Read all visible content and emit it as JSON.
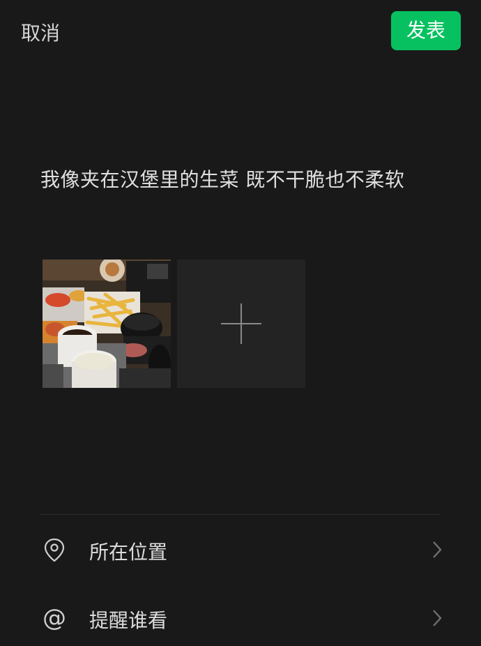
{
  "header": {
    "cancel_label": "取消",
    "publish_label": "发表"
  },
  "post": {
    "text": "我像夹在汉堡里的生菜 既不干脆也不柔软"
  },
  "media": {
    "photos": [
      {
        "description_icon": "photo-thumbnail"
      }
    ],
    "add_icon": "plus-icon"
  },
  "options": {
    "location": {
      "label": "所在位置",
      "icon": "location-pin-icon"
    },
    "mention": {
      "label": "提醒谁看",
      "icon": "at-icon",
      "glyph": "@"
    }
  },
  "colors": {
    "background": "#191919",
    "accent": "#07c160",
    "text": "#e0e0e0",
    "secondary": "#8a8a8a"
  }
}
